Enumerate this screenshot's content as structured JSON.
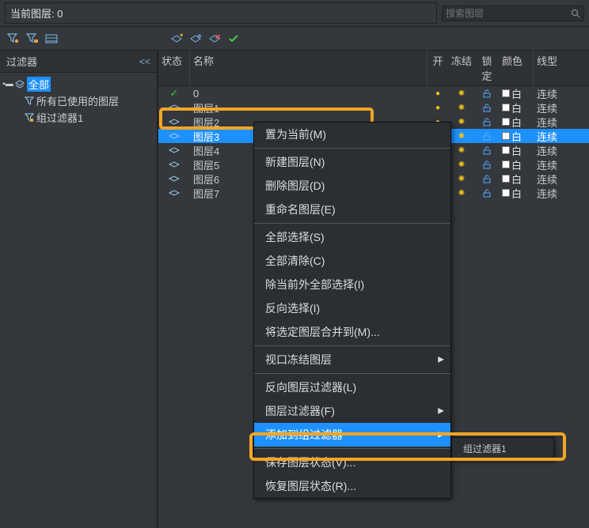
{
  "header": {
    "current_layer_prefix": "当前图层:",
    "current_layer_value": "0",
    "search_placeholder": "搜索图层"
  },
  "sidebar": {
    "title": "过滤器",
    "collapse_glyph": "<<",
    "tree": {
      "root": "全部",
      "children": [
        {
          "label": "所有已使用的图层"
        },
        {
          "label": "组过滤器1"
        }
      ]
    }
  },
  "table": {
    "columns": {
      "status": "状态",
      "name": "名称",
      "on": "开",
      "freeze": "冻结",
      "lock": "锁定",
      "color": "颜色",
      "linetype": "线型"
    },
    "rows": [
      {
        "name": "0",
        "current": true,
        "color": "白",
        "ltype": "连续",
        "selected": false
      },
      {
        "name": "图层1",
        "current": false,
        "color": "白",
        "ltype": "连续",
        "selected": false
      },
      {
        "name": "图层2",
        "current": false,
        "color": "白",
        "ltype": "连续",
        "selected": false
      },
      {
        "name": "图层3",
        "current": false,
        "color": "白",
        "ltype": "连续",
        "selected": true
      },
      {
        "name": "图层4",
        "current": false,
        "color": "白",
        "ltype": "连续",
        "selected": false
      },
      {
        "name": "图层5",
        "current": false,
        "color": "白",
        "ltype": "连续",
        "selected": false
      },
      {
        "name": "图层6",
        "current": false,
        "color": "白",
        "ltype": "连续",
        "selected": false
      },
      {
        "name": "图层7",
        "current": false,
        "color": "白",
        "ltype": "连续",
        "selected": false
      }
    ]
  },
  "context_menu": {
    "items": [
      {
        "label": "置为当前(M)"
      },
      {
        "sep": true
      },
      {
        "label": "新建图层(N)"
      },
      {
        "label": "删除图层(D)"
      },
      {
        "label": "重命名图层(E)"
      },
      {
        "sep": true
      },
      {
        "label": "全部选择(S)"
      },
      {
        "label": "全部清除(C)"
      },
      {
        "label": "除当前外全部选择(I)"
      },
      {
        "label": "反向选择(I)"
      },
      {
        "label": "将选定图层合并到(M)..."
      },
      {
        "sep": true
      },
      {
        "label": "视口冻结图层",
        "submenu": true
      },
      {
        "sep": true
      },
      {
        "label": "反向图层过滤器(L)"
      },
      {
        "label": "图层过滤器(F)",
        "submenu": true
      },
      {
        "label": "添加到组过滤器",
        "submenu": true,
        "highlighted": true
      },
      {
        "sep": true
      },
      {
        "label": "保存图层状态(V)..."
      },
      {
        "label": "恢复图层状态(R)..."
      }
    ],
    "submenu_add_to_group": {
      "items": [
        {
          "label": "组过滤器1"
        }
      ]
    }
  }
}
